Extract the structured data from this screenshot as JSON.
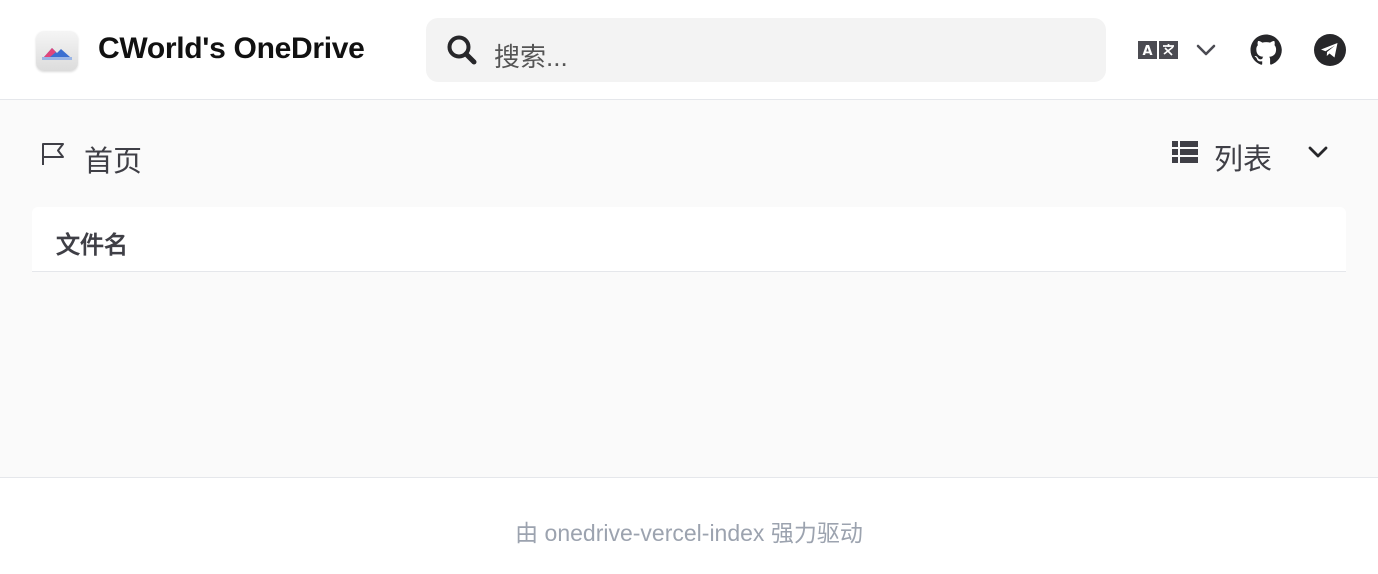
{
  "header": {
    "site_title": "CWorld's OneDrive",
    "logo_icon": "onedrive-mountain-logo",
    "search": {
      "placeholder": "搜索..."
    },
    "language_icon": "translate-icon",
    "github_icon": "github-icon",
    "telegram_icon": "telegram-icon"
  },
  "toolbar": {
    "breadcrumb_home": "首页",
    "layout_label": "列表"
  },
  "file_list": {
    "columns": [
      "文件名"
    ],
    "rows": []
  },
  "footer": {
    "prefix": "由",
    "link_text": "onedrive-vercel-index",
    "suffix": "强力驱动"
  },
  "colors": {
    "background": "#fafafa",
    "surface": "#ffffff",
    "search_bg": "#f3f3f3",
    "text_primary": "#111111",
    "text_muted": "#9ca3af",
    "icon": "#3f3f46"
  }
}
